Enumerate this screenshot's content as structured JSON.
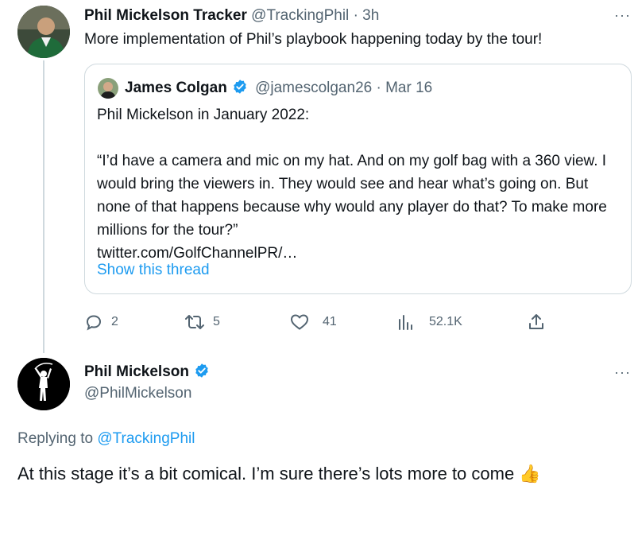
{
  "tweet1": {
    "author_name": "Phil Mickelson Tracker",
    "handle": "@TrackingPhil",
    "separator": "·",
    "time": "3h",
    "text": "More implementation of Phil’s playbook happening today by the tour!",
    "more_icon": "ellipsis-icon",
    "quote": {
      "author_name": "James Colgan",
      "handle": "@jamescolgan26",
      "separator": "·",
      "date": "Mar 16",
      "text": "Phil Mickelson in January 2022:\n\n“I’d have a camera and mic on my hat. And on my golf bag with a 360 view. I would bring the viewers in. They would see and hear what’s going on. But none of that happens because why would any player do that? To make more millions for the tour?”\ntwitter.com/GolfChannelPR/…",
      "show_thread": "Show this thread"
    },
    "actions": {
      "replies": "2",
      "retweets": "5",
      "likes": "41",
      "views": "52.1K"
    }
  },
  "tweet2": {
    "author_name": "Phil Mickelson",
    "handle": "@PhilMickelson",
    "replying_prefix": "Replying to",
    "replying_to": "@TrackingPhil",
    "text": "At this stage it’s a bit comical. I’m sure there’s lots more to come",
    "emoji": "👍"
  },
  "colors": {
    "accent": "#1d9bf0",
    "muted": "#536471",
    "border": "#cfd9de",
    "text": "#0f1419"
  }
}
